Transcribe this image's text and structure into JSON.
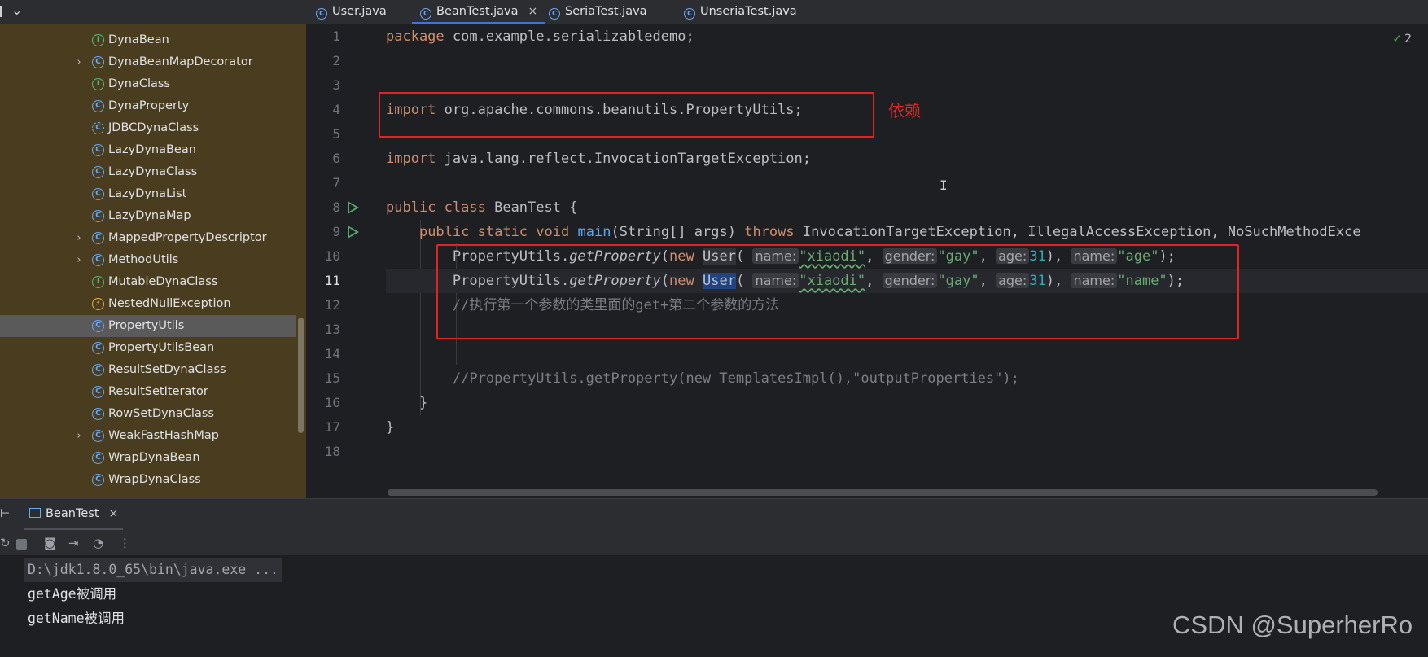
{
  "sidebar": {
    "items": [
      {
        "label": "DynaBean",
        "kind": "iface",
        "glyph": "I",
        "expandable": false
      },
      {
        "label": "DynaBeanMapDecorator",
        "kind": "class",
        "glyph": "C",
        "expandable": true
      },
      {
        "label": "DynaClass",
        "kind": "iface",
        "glyph": "I",
        "expandable": false
      },
      {
        "label": "DynaProperty",
        "kind": "class",
        "glyph": "C",
        "expandable": false
      },
      {
        "label": "JDBCDynaClass",
        "kind": "abs",
        "glyph": "C",
        "expandable": false
      },
      {
        "label": "LazyDynaBean",
        "kind": "class",
        "glyph": "C",
        "expandable": false
      },
      {
        "label": "LazyDynaClass",
        "kind": "class",
        "glyph": "C",
        "expandable": false
      },
      {
        "label": "LazyDynaList",
        "kind": "class",
        "glyph": "C",
        "expandable": false
      },
      {
        "label": "LazyDynaMap",
        "kind": "class",
        "glyph": "C",
        "expandable": false
      },
      {
        "label": "MappedPropertyDescriptor",
        "kind": "class",
        "glyph": "C",
        "expandable": true
      },
      {
        "label": "MethodUtils",
        "kind": "class",
        "glyph": "C",
        "expandable": true
      },
      {
        "label": "MutableDynaClass",
        "kind": "iface",
        "glyph": "I",
        "expandable": false
      },
      {
        "label": "NestedNullException",
        "kind": "exc",
        "glyph": "⚡",
        "expandable": false
      },
      {
        "label": "PropertyUtils",
        "kind": "class",
        "glyph": "C",
        "expandable": false,
        "selected": true
      },
      {
        "label": "PropertyUtilsBean",
        "kind": "class",
        "glyph": "C",
        "expandable": false
      },
      {
        "label": "ResultSetDynaClass",
        "kind": "class",
        "glyph": "C",
        "expandable": false
      },
      {
        "label": "ResultSetIterator",
        "kind": "class",
        "glyph": "C",
        "expandable": false
      },
      {
        "label": "RowSetDynaClass",
        "kind": "class",
        "glyph": "C",
        "expandable": false
      },
      {
        "label": "WeakFastHashMap",
        "kind": "class",
        "glyph": "C",
        "expandable": true
      },
      {
        "label": "WrapDynaBean",
        "kind": "class",
        "glyph": "C",
        "expandable": false
      },
      {
        "label": "WrapDynaClass",
        "kind": "class",
        "glyph": "C",
        "expandable": false
      }
    ]
  },
  "tabs": [
    {
      "label": "User.java",
      "active": false
    },
    {
      "label": "BeanTest.java",
      "active": true,
      "close": "×"
    },
    {
      "label": "SeriaTest.java",
      "active": false
    },
    {
      "label": "UnseriaTest.java",
      "active": false
    }
  ],
  "editor": {
    "line_numbers": [
      "1",
      "2",
      "3",
      "4",
      "5",
      "6",
      "7",
      "8",
      "9",
      "10",
      "11",
      "12",
      "13",
      "14",
      "15",
      "16",
      "17",
      "18"
    ],
    "current_line": "11",
    "inspection_count": "2",
    "code": {
      "l1_kw": "package",
      "l1_rest": " com.example.serializabledemo;",
      "l4_kw": "import",
      "l4_rest": " org.apache.commons.beanutils.PropertyUtils;",
      "l6_kw": "import",
      "l6_rest": " java.lang.reflect.InvocationTargetException;",
      "l8_kw1": "public",
      "l8_kw2": "class",
      "l8_rest": " BeanTest {",
      "l9_indent": "    ",
      "l9_kw1": "public",
      "l9_kw2": "static",
      "l9_kw3": "void",
      "l9_fn": "main",
      "l9_args": "(String[] args) ",
      "l9_kw4": "throws",
      "l9_rest": " InvocationTargetException, IllegalAccessException, NoSuchMethodExce",
      "call_indent": "        ",
      "call_cls": "PropertyUtils.",
      "call_fn": "getProperty",
      "call_open": "(",
      "call_new": "new",
      "call_user": "User",
      "hint_name": "name:",
      "str_xiaodi": "\"xiaodi\"",
      "hint_gender": "gender:",
      "str_gay": "\"gay\"",
      "hint_age": "age:",
      "num_age": "31",
      "str_prop10": "\"age\"",
      "str_prop11": "\"name\"",
      "l12_comment": "//执行第一个参数的类里面的get+第二个参数的方法",
      "l15_comment": "//PropertyUtils.getProperty(new TemplatesImpl(),\"outputProperties\");",
      "l16_brace": "    }",
      "l17_brace": "}"
    },
    "annotation": "依赖"
  },
  "run_panel": {
    "tab_label": "BeanTest",
    "tab_close": "×",
    "console": [
      "D:\\jdk1.8.0_65\\bin\\java.exe ...",
      "getAge被调用",
      "getName被调用"
    ]
  },
  "watermark": "CSDN @SuperherRo",
  "colors": {
    "sidebar_bg": "#4a3d1f",
    "editor_bg": "#1e1f22",
    "annotation_red": "#e02424",
    "keyword": "#cf8e6d",
    "string": "#6aab73"
  }
}
